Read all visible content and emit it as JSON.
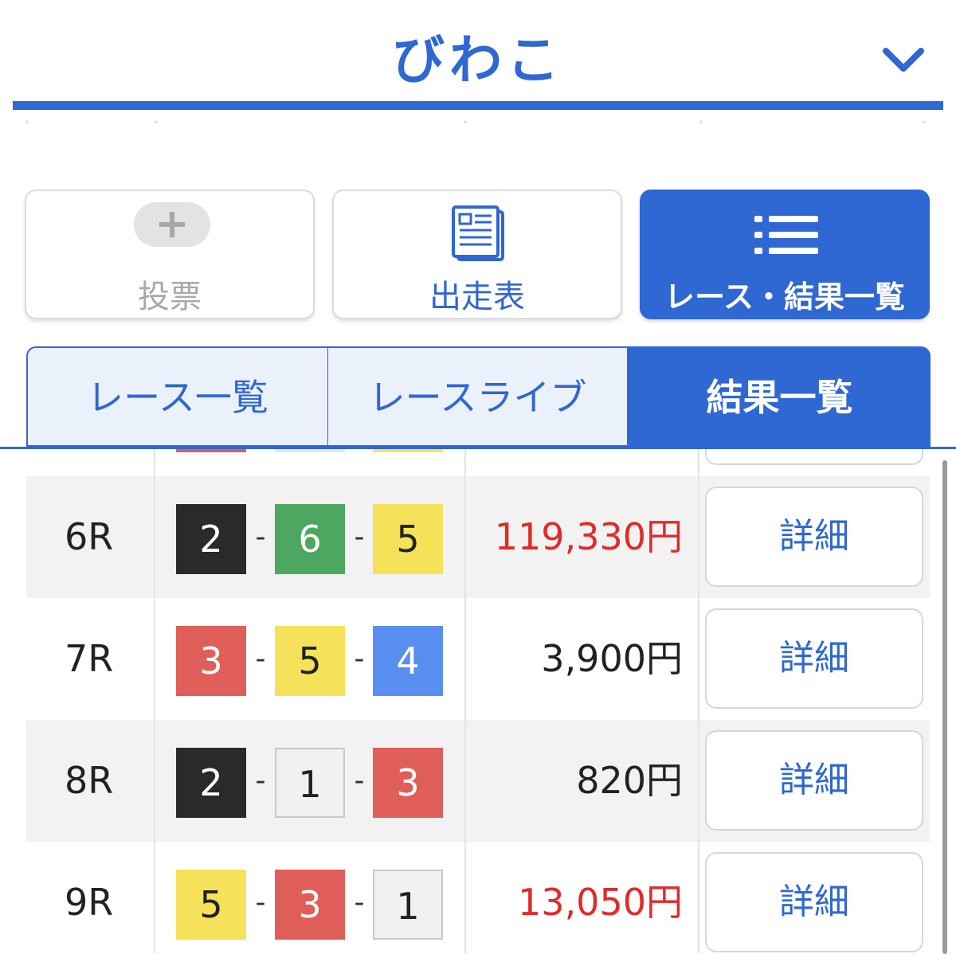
{
  "header": {
    "venue_name": "びわこ"
  },
  "main_buttons": {
    "vote_label": "投票",
    "program_label": "出走表",
    "results_label": "レース・結果一覧"
  },
  "tabs": [
    {
      "label": "レース一覧"
    },
    {
      "label": "レースライブ"
    },
    {
      "label": "結果一覧"
    }
  ],
  "colors": {
    "accent": "#2f67d3",
    "payout_high": "#e02b2b",
    "boat_1": "#f1f1f1",
    "boat_2": "#2a2a2a",
    "boat_3": "#e05e5a",
    "boat_4": "#588ef0",
    "boat_5": "#f5e25a",
    "boat_6": "#4da761"
  },
  "results": [
    {
      "race": "6R",
      "boats": [
        "2",
        "6",
        "5"
      ],
      "payout": "119,330円",
      "high": true,
      "detail_label": "詳細"
    },
    {
      "race": "7R",
      "boats": [
        "3",
        "5",
        "4"
      ],
      "payout": "3,900円",
      "high": false,
      "detail_label": "詳細"
    },
    {
      "race": "8R",
      "boats": [
        "2",
        "1",
        "3"
      ],
      "payout": "820円",
      "high": false,
      "detail_label": "詳細"
    },
    {
      "race": "9R",
      "boats": [
        "5",
        "3",
        "1"
      ],
      "payout": "13,050円",
      "high": true,
      "detail_label": "詳細"
    }
  ]
}
